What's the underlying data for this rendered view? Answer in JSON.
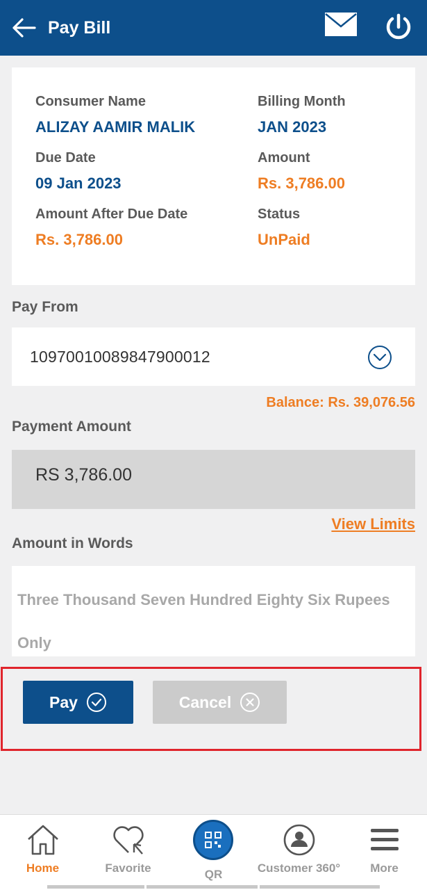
{
  "header": {
    "title": "Pay Bill"
  },
  "bill": {
    "consumer_name_label": "Consumer Name",
    "consumer_name": "ALIZAY AAMIR MALIK",
    "billing_month_label": "Billing Month",
    "billing_month": "JAN 2023",
    "due_date_label": "Due Date",
    "due_date": "09 Jan 2023",
    "amount_label": "Amount",
    "amount": "Rs. 3,786.00",
    "after_due_label": "Amount After Due Date",
    "after_due": "Rs. 3,786.00",
    "status_label": "Status",
    "status": "UnPaid"
  },
  "pay_from": {
    "label": "Pay From",
    "account": "10970010089847900012",
    "balance": "Balance: Rs. 39,076.56"
  },
  "payment_amount": {
    "label": "Payment Amount",
    "value": "RS 3,786.00",
    "view_limits": "View Limits"
  },
  "amount_in_words": {
    "label": "Amount in Words",
    "value": "Three Thousand Seven Hundred Eighty Six Rupees Only"
  },
  "actions": {
    "pay": "Pay",
    "cancel": "Cancel"
  },
  "nav": {
    "items": [
      {
        "label": "Home",
        "icon": "home-icon",
        "active": true
      },
      {
        "label": "Favorite",
        "icon": "heart-icon",
        "active": false
      },
      {
        "label": "QR",
        "icon": "qr-icon",
        "active": false
      },
      {
        "label": "Customer 360°",
        "icon": "customer-icon",
        "active": false
      },
      {
        "label": "More",
        "icon": "menu-icon",
        "active": false
      }
    ]
  },
  "colors": {
    "brand_blue": "#0d4f8b",
    "accent_orange": "#ee7d23",
    "highlight_red": "#e0242c"
  }
}
